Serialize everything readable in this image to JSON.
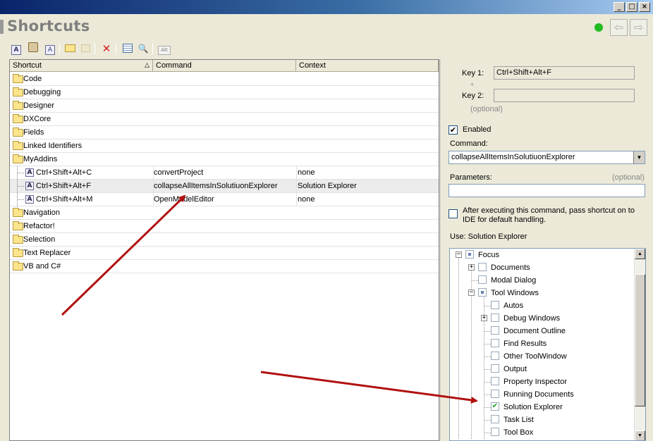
{
  "window": {
    "title": "Shortcuts",
    "controls": {
      "minimize": "_",
      "maximize": "□",
      "close": "×"
    }
  },
  "nav": {
    "back_glyph": "⇦",
    "forward_glyph": "⇨",
    "status_color": "#22bb22"
  },
  "toolbar": {
    "icons": [
      "new-shortcut-icon",
      "new-keystroke-icon",
      "new-text-shortcut-icon",
      "new-folder-icon",
      "folder-disabled-icon",
      "delete-icon",
      "list-view-icon",
      "find-icon",
      "alt-key-icon"
    ],
    "glyphs": {
      "new": "A",
      "delete": "✕",
      "find": "🔍",
      "alt": "Alt"
    }
  },
  "grid": {
    "columns": [
      "Shortcut",
      "Command",
      "Context"
    ],
    "sort_indicator": "△",
    "rows": [
      {
        "type": "folder",
        "label": "Code"
      },
      {
        "type": "folder",
        "label": "Debugging"
      },
      {
        "type": "folder",
        "label": "Designer"
      },
      {
        "type": "folder",
        "label": "DXCore"
      },
      {
        "type": "folder",
        "label": "Fields"
      },
      {
        "type": "folder",
        "label": "Linked Identifiers"
      },
      {
        "type": "folder",
        "label": "MyAddins"
      },
      {
        "type": "shortcut",
        "label": "Ctrl+Shift+Alt+C",
        "command": "convertProject",
        "context": "none"
      },
      {
        "type": "shortcut",
        "label": "Ctrl+Shift+Alt+F",
        "command": "collapseAllItemsInSolutiuonExplorer",
        "context": "Solution Explorer",
        "selected": true
      },
      {
        "type": "shortcut",
        "label": "Ctrl+Shift+Alt+M",
        "command": "OpenModelEditor",
        "context": "none"
      },
      {
        "type": "folder",
        "label": "Navigation"
      },
      {
        "type": "folder",
        "label": "Refactor!"
      },
      {
        "type": "folder",
        "label": "Selection"
      },
      {
        "type": "folder",
        "label": "Text Replacer"
      },
      {
        "type": "folder",
        "label": "VB and C#"
      }
    ]
  },
  "details": {
    "key1_label": "Key 1:",
    "key1_value": "Ctrl+Shift+Alt+F",
    "plus": "+",
    "key2_label": "Key 2:",
    "key2_value": "",
    "optional_hint": "(optional)",
    "enabled_label": "Enabled",
    "enabled_check": "✔",
    "command_label": "Command:",
    "command_value": "collapseAllItemsInSolutiuonExplorer",
    "parameters_label": "Parameters:",
    "parameters_hint": "(optional)",
    "parameters_value": "",
    "pass_line1": "After executing this command, pass shortcut on to",
    "pass_line2": "IDE for default handling.",
    "use_label": "Use:  Solution Explorer"
  },
  "context_tree": [
    {
      "label": "Focus",
      "state": "partial",
      "expander": "−"
    },
    {
      "label": "Documents",
      "state": "none",
      "expander": "+"
    },
    {
      "label": "Modal Dialog",
      "state": "none"
    },
    {
      "label": "Tool Windows",
      "state": "partial",
      "expander": "−"
    },
    {
      "label": "Autos",
      "state": "none"
    },
    {
      "label": "Debug Windows",
      "state": "none",
      "expander": "+"
    },
    {
      "label": "Document Outline",
      "state": "none"
    },
    {
      "label": "Find Results",
      "state": "none"
    },
    {
      "label": "Other ToolWindow",
      "state": "none"
    },
    {
      "label": "Output",
      "state": "none"
    },
    {
      "label": "Property Inspector",
      "state": "none"
    },
    {
      "label": "Running Documents",
      "state": "none"
    },
    {
      "label": "Solution Explorer",
      "state": "checked",
      "check": "✔"
    },
    {
      "label": "Task List",
      "state": "none"
    },
    {
      "label": "Tool Box",
      "state": "none"
    }
  ],
  "annotation_color": "#b01010"
}
